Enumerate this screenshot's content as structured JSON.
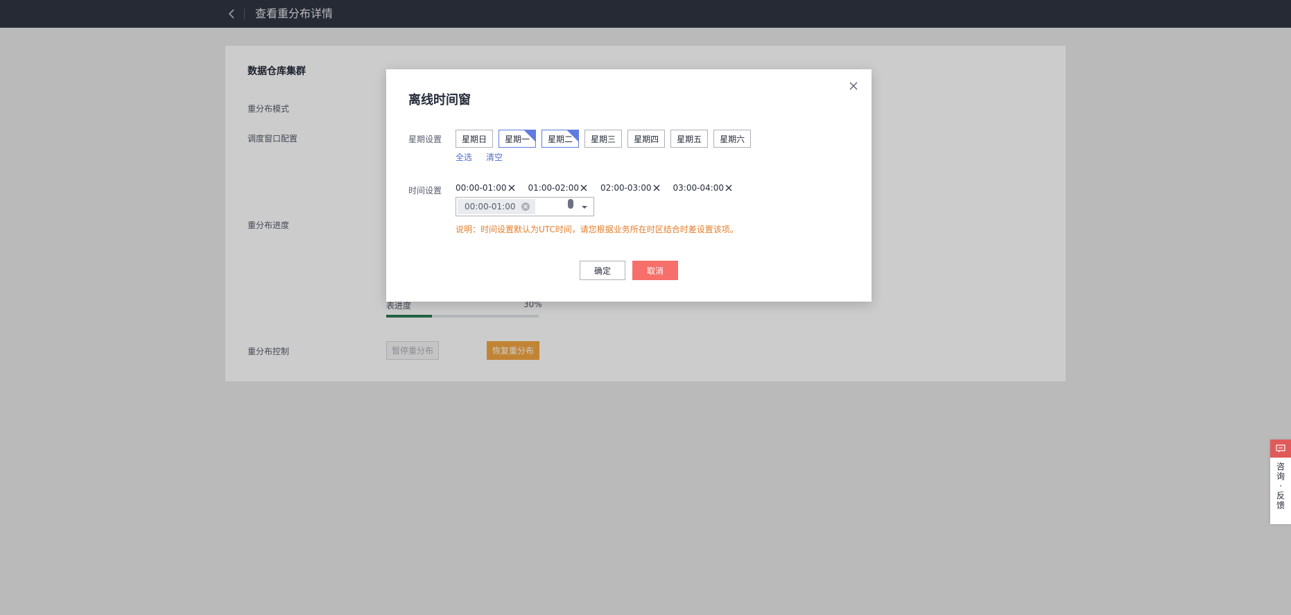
{
  "header": {
    "title": "查看重分布详情"
  },
  "card": {
    "section_title": "数据仓库集群",
    "labels": {
      "mode": "重分布模式",
      "window": "调度窗口配置",
      "progress": "重分布进度",
      "control": "重分布控制"
    },
    "table_progress": {
      "label": "表进度",
      "percent_text": "30%",
      "value": 0.3
    },
    "buttons": {
      "pause": "暂停重分布",
      "resume": "恢复重分布"
    }
  },
  "modal": {
    "title": "离线时间窗",
    "week_label": "星期设置",
    "weekdays": [
      {
        "label": "星期日",
        "selected": false
      },
      {
        "label": "星期一",
        "selected": true
      },
      {
        "label": "星期二",
        "selected": true
      },
      {
        "label": "星期三",
        "selected": false
      },
      {
        "label": "星期四",
        "selected": false
      },
      {
        "label": "星期五",
        "selected": false
      },
      {
        "label": "星期六",
        "selected": false
      }
    ],
    "select_all": "全选",
    "clear": "清空",
    "time_label": "时间设置",
    "time_tags": [
      "00:00-01:00",
      "01:00-02:00",
      "02:00-03:00",
      "03:00-04:00"
    ],
    "select_chip": "00:00-01:00",
    "note": "说明：时间设置默认为UTC时间，请您根据业务所在时区结合时差设置该项。",
    "ok": "确定",
    "cancel": "取消"
  },
  "float_widget": {
    "text": "咨询·反馈"
  },
  "colors": {
    "topbar": "#2f3541",
    "accent_blue": "#5e7ce0",
    "cancel_red": "#f66f6a",
    "warning_orange": "#e37d29",
    "resume_orange": "#f2a541",
    "progress_green": "#2b7a56"
  }
}
